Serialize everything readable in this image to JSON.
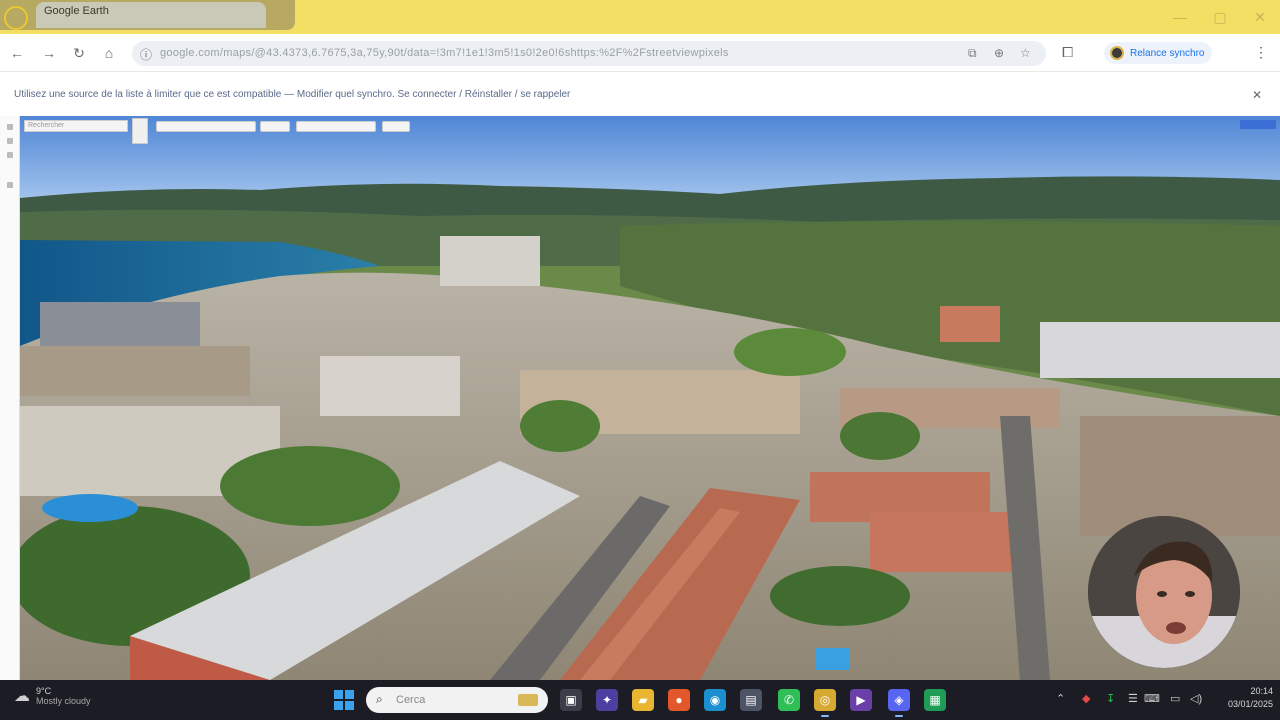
{
  "browser": {
    "tab_title": "Google Earth",
    "tab_subtitle": "",
    "url": "google.com/maps/@43.4373,6.7675,3a,75y,90t/data=!3m7!1e1!3m5!1s0!2e0!6shttps:%2F%2Fstreetviewpixels",
    "profile_label": "Relance synchro",
    "window_controls": [
      "—",
      "▢",
      "✕"
    ]
  },
  "infobar": {
    "text": "Utilisez une source de la liste à limiter que ce est compatible — Modifier quel synchro. Se connecter / Réinstaller / se rappeler",
    "close_glyph": "✕"
  },
  "map": {
    "search_placeholder": "Rechercher"
  },
  "taskbar": {
    "weather_temp": "9°C",
    "weather_desc": "Mostly cloudy",
    "search_placeholder": "Cerca",
    "clock_time": "20:14",
    "clock_date": "03/01/2025",
    "apps": [
      {
        "name": "task-view",
        "glyph": "▣",
        "color": "#3b3d48"
      },
      {
        "name": "copilot",
        "glyph": "✦",
        "color": "#4b3fa0"
      },
      {
        "name": "file-explorer",
        "glyph": "▰",
        "color": "#e8b630"
      },
      {
        "name": "firefox",
        "glyph": "●",
        "color": "#e2582a"
      },
      {
        "name": "edge",
        "glyph": "◉",
        "color": "#1b8fcf"
      },
      {
        "name": "notepad",
        "glyph": "▤",
        "color": "#4d5466"
      },
      {
        "name": "whatsapp",
        "glyph": "✆",
        "color": "#2fbf56"
      },
      {
        "name": "chrome",
        "glyph": "◎",
        "color": "#d6a933"
      },
      {
        "name": "media-player",
        "glyph": "▶",
        "color": "#6b3fa8"
      },
      {
        "name": "discord",
        "glyph": "◈",
        "color": "#5865f2"
      },
      {
        "name": "sheets",
        "glyph": "▦",
        "color": "#1f9d57"
      }
    ]
  }
}
